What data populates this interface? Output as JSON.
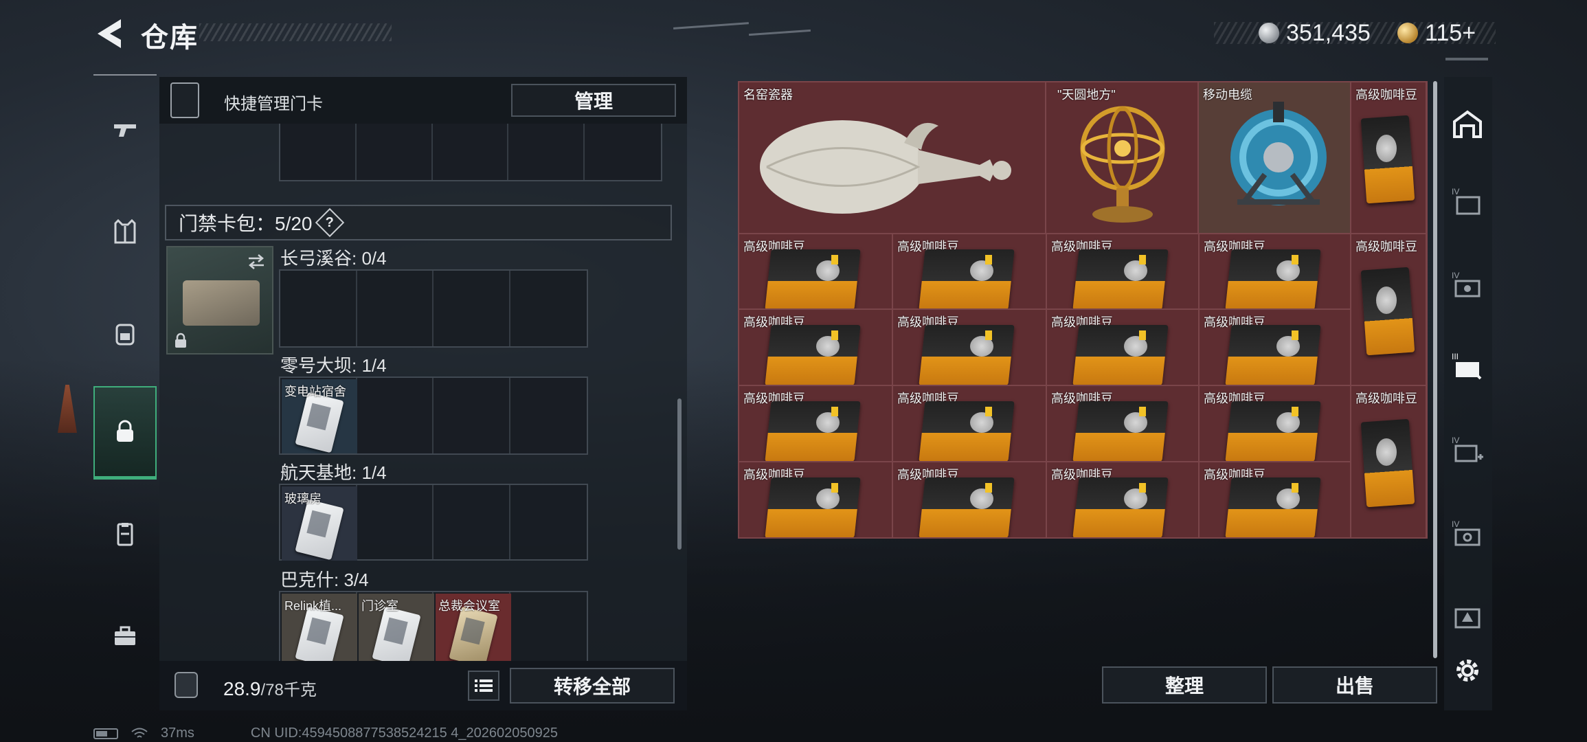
{
  "header": {
    "title": "仓库",
    "currency_silver": "351,435",
    "currency_gold": "115+"
  },
  "quick_manage": {
    "label": "快捷管理门卡",
    "button": "管理"
  },
  "card_bag": {
    "label": "门禁卡包：5/20",
    "help": "?"
  },
  "zones": [
    {
      "label": "长弓溪谷: 0/4",
      "cards": []
    },
    {
      "label": "零号大坝: 1/4",
      "cards": [
        "变电站宿舍"
      ]
    },
    {
      "label": "航天基地: 1/4",
      "cards": [
        "玻璃房"
      ]
    },
    {
      "label": "巴克什: 3/4",
      "cards": [
        "Relink植...",
        "门诊室",
        "总裁会议室"
      ]
    }
  ],
  "weight": {
    "current": "28.9",
    "max": "/78千克"
  },
  "buttons": {
    "transfer_all": "转移全部",
    "organize": "整理",
    "sell": "出售"
  },
  "inventory": {
    "top_items": [
      "名窑瓷器",
      "\"天圆地方\"",
      "移动电缆",
      "高级咖啡豆"
    ],
    "coffee_label": "高级咖啡豆"
  },
  "status_bar": {
    "ping": "37ms",
    "uid": "CN UID:4594508877538524215 4_202602050925"
  },
  "colors": {
    "accent_green": "#3fae7c",
    "inventory_bg": "#5e2d31"
  }
}
